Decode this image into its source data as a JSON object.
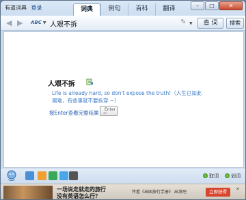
{
  "titlebar": {
    "app_name": "有道词典",
    "login": "登录",
    "tabs": [
      {
        "label": "词典",
        "active": true
      },
      {
        "label": "例句",
        "active": false
      },
      {
        "label": "百科",
        "active": false
      },
      {
        "label": "翻译",
        "active": false
      }
    ],
    "window_buttons": {
      "minimize": "–",
      "maximize": "□",
      "close": "✕"
    }
  },
  "toolbar": {
    "back_icon": "back-arrow-icon",
    "forward_icon": "forward-arrow-icon",
    "lang_selector": "ABC",
    "search_value": "人艰不拆",
    "lookup_label": "查 词",
    "search_label": "搜索"
  },
  "content": {
    "word": "人艰不拆",
    "translation": "Life is already hard, so don't expose the truth!（人生已如此艰难，有些事就不要拆穿 ~）",
    "enter_hint": "按Enter查看完整结果",
    "enter_key": "Enter"
  },
  "bottom": {
    "icons": [
      "helper-icon",
      "book-icon",
      "m-icon",
      "chat-icon",
      "cycle-icon",
      "phone-icon"
    ],
    "radio_left": "取词",
    "radio_right": "划词"
  },
  "ad": {
    "line1": "一场说走就走的旅行",
    "line2": "没有英语怎么行？",
    "promo": "传看《出国旅行手册》 出发吧",
    "button": "立即获得",
    "close": "✕"
  },
  "colors": {
    "accent": "#3d7cc9",
    "close": "#c94a2f",
    "radio": "#6bbf3a"
  }
}
